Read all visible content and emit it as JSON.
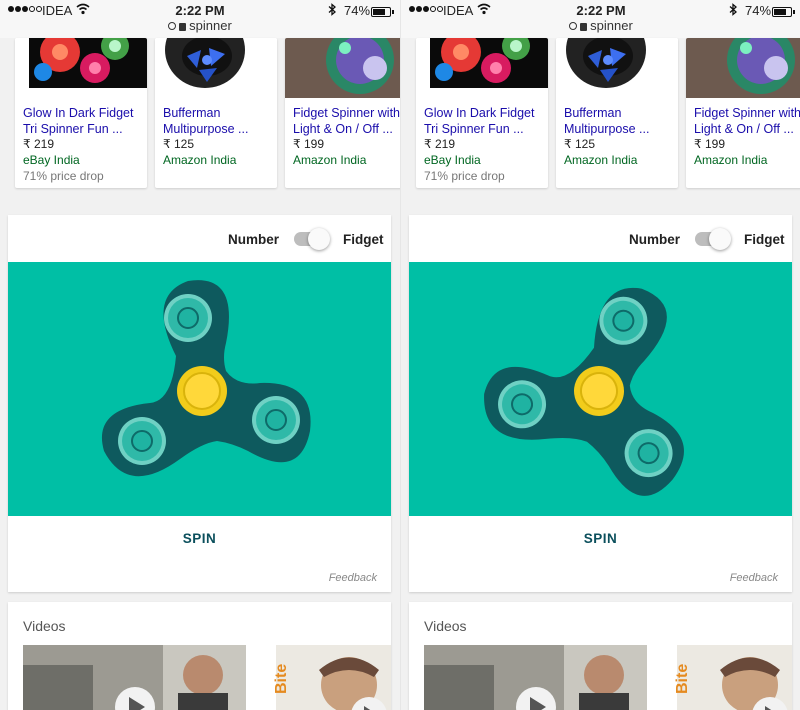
{
  "colors": {
    "teal_bg": "#00bfa5",
    "spinner_body": "#0e5a5e",
    "bearing_ring": "#6fd1c4",
    "bearing_core": "#1fb3a2",
    "center_yellow": "#f2cc1b"
  },
  "status": {
    "carrier": "IDEA",
    "time": "2:22 PM",
    "battery": "74%",
    "battery_level": 0.74,
    "url": "spinner"
  },
  "products": [
    {
      "title": "Glow In Dark Fidget Tri Spinner Fun ...",
      "price": "₹ 219",
      "store": "eBay India",
      "note": "71% price drop"
    },
    {
      "title": "Bufferman Multipurpose ...",
      "price": "₹ 125",
      "store": "Amazon India",
      "note": ""
    },
    {
      "title": "Fidget Spinner with Light & On / Off ...",
      "price": "₹ 199",
      "store": "Amazon India",
      "note": ""
    }
  ],
  "spinner": {
    "label_left": "Number",
    "label_right": "Fidget",
    "spin": "SPIN",
    "feedback": "Feedback"
  },
  "videos": {
    "title": "Videos"
  },
  "screens": [
    {
      "rotation_deg": 0
    },
    {
      "rotation_deg": 30
    }
  ]
}
